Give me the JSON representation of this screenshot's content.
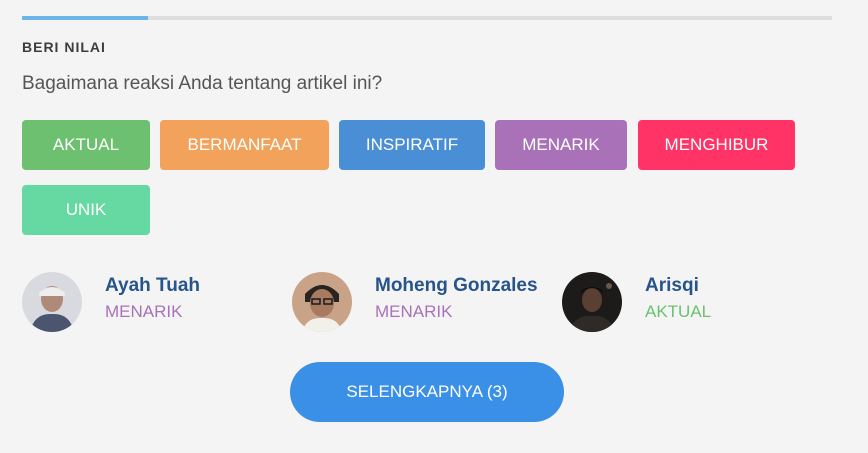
{
  "section": {
    "title": "BERI NILAI",
    "question": "Bagaimana reaksi Anda tentang artikel ini?"
  },
  "reactions": [
    {
      "label": "AKTUAL",
      "color": "#6cc070"
    },
    {
      "label": "BERMANFAAT",
      "color": "#f2a25a"
    },
    {
      "label": "INSPIRATIF",
      "color": "#4a8fd6"
    },
    {
      "label": "MENARIK",
      "color": "#a972b8"
    },
    {
      "label": "MENGHIBUR",
      "color": "#ff3366"
    },
    {
      "label": "UNIK",
      "color": "#66d9a3"
    }
  ],
  "voters": [
    {
      "name": "Ayah Tuah",
      "reaction": "MENARIK",
      "reaction_color": "#a972b8"
    },
    {
      "name": "Moheng Gonzales",
      "reaction": "MENARIK",
      "reaction_color": "#a972b8"
    },
    {
      "name": "Arisqi",
      "reaction": "AKTUAL",
      "reaction_color": "#6cc070"
    }
  ],
  "more_button": {
    "label": "SELENGKAPNYA (3)"
  }
}
